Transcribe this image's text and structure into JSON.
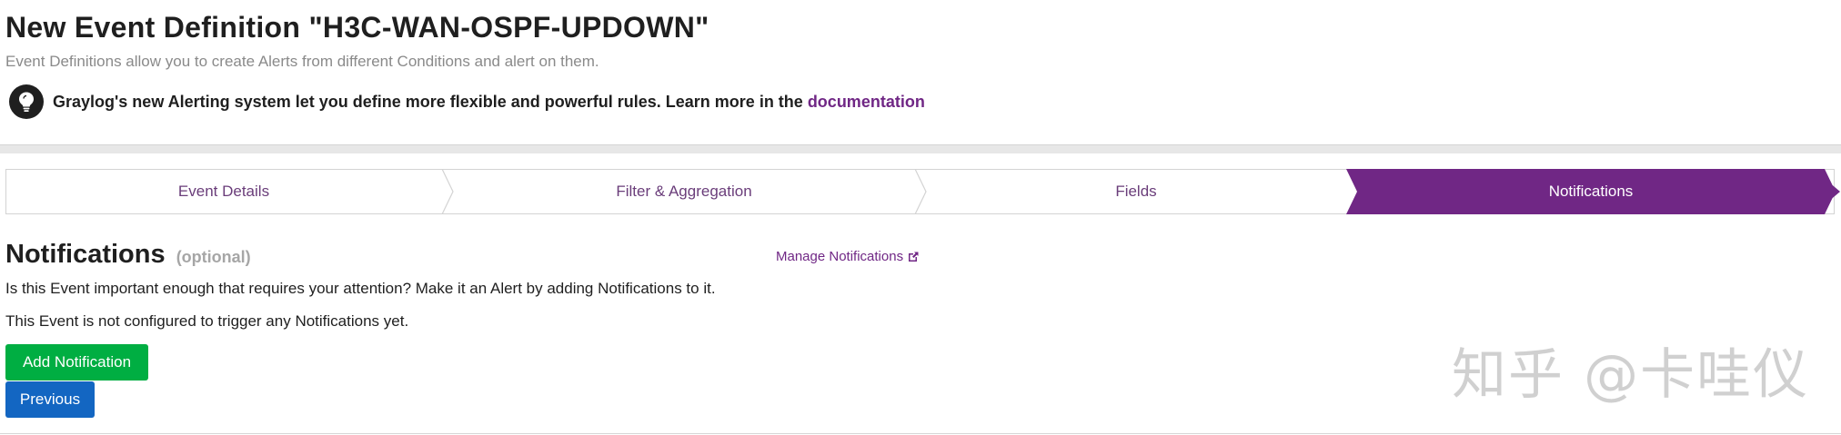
{
  "header": {
    "title": "New Event Definition \"H3C-WAN-OSPF-UPDOWN\"",
    "subtitle": "Event Definitions allow you to create Alerts from different Conditions and alert on them.",
    "info": {
      "icon": "lightbulb-icon",
      "text": "Graylog's new Alerting system let you define more flexible and powerful rules. Learn more in the ",
      "link_label": "documentation"
    }
  },
  "wizard": {
    "steps": [
      {
        "label": "Event Details",
        "active": false
      },
      {
        "label": "Filter & Aggregation",
        "active": false
      },
      {
        "label": "Fields",
        "active": false
      },
      {
        "label": "Notifications",
        "active": true
      }
    ],
    "active_color": "#702785"
  },
  "notifications": {
    "title": "Notifications",
    "optional": "(optional)",
    "manage_link": "Manage Notifications",
    "description": "Is this Event important enough that requires your attention? Make it an Alert by adding Notifications to it.",
    "status": "This Event is not configured to trigger any Notifications yet.",
    "add_button": "Add Notification",
    "previous_button": "Previous"
  },
  "watermark": {
    "text": "知乎 @卡哇仪"
  },
  "colors": {
    "brand_purple": "#702785",
    "success_green": "#00ae42",
    "primary_blue": "#1366c2"
  }
}
